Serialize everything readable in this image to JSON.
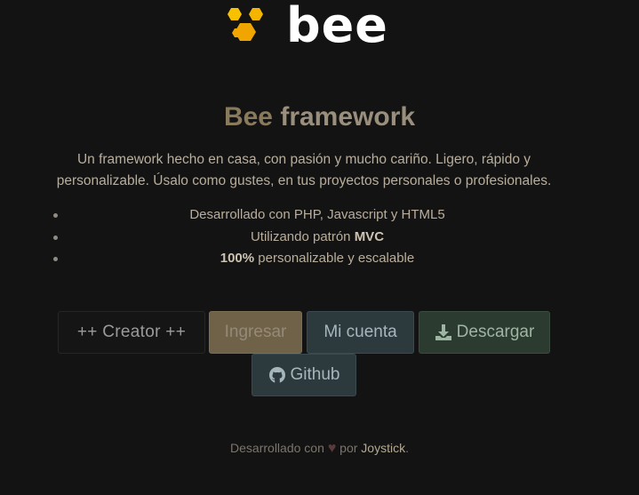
{
  "brand": {
    "logo_text": "bee",
    "accent": "#f5b400"
  },
  "hero": {
    "title_word1": "Bee",
    "title_word2": "framework",
    "description": "Un framework hecho en casa, con pasión y mucho cariño. Ligero, rápido y personalizable. Úsalo como gustes, en tus proyectos personales o profesionales."
  },
  "features": {
    "item1": "Desarrollado con PHP, Javascript y HTML5",
    "item2_prefix": "Utilizando patrón ",
    "item2_bold": "MVC",
    "item3_bold": "100%",
    "item3_suffix": " personalizable y escalable"
  },
  "buttons": {
    "creator": "++ Creator ++",
    "ingresar": "Ingresar",
    "mi_cuenta": "Mi cuenta",
    "descargar": "Descargar",
    "github": "Github"
  },
  "footer": {
    "prefix": "Desarrollado con",
    "heart": "♥",
    "by": "por",
    "author": "Joystick",
    "suffix": "."
  }
}
